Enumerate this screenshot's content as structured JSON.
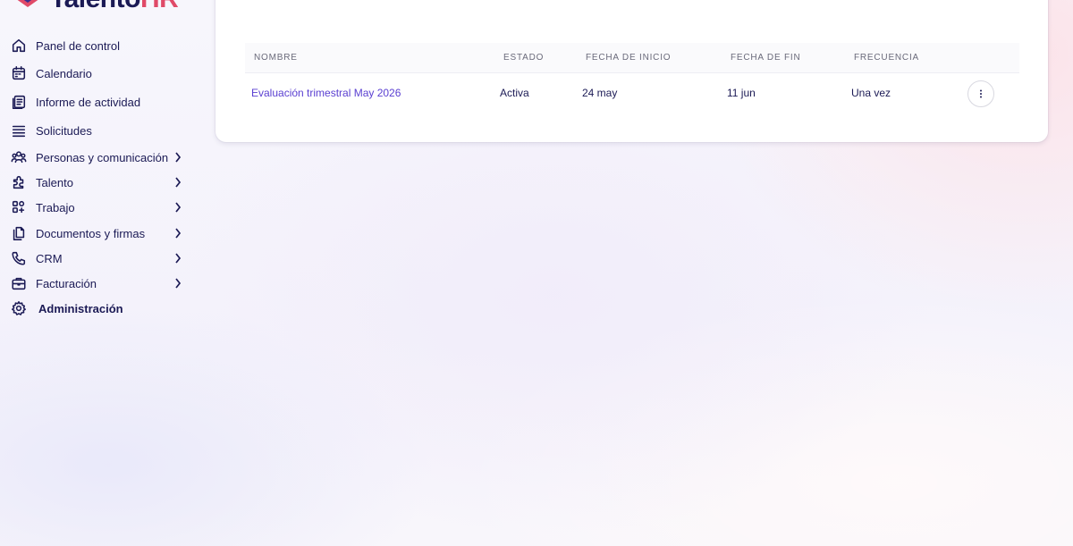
{
  "brand": {
    "name_main": "Talento",
    "name_accent": "HR",
    "colors": {
      "primary": "#1b1a55",
      "accent": "#e04a68",
      "link": "#5a3fd1"
    }
  },
  "sidebar": {
    "items": [
      {
        "label": "Panel de control",
        "icon": "home-icon",
        "has_submenu": false
      },
      {
        "label": "Calendario",
        "icon": "calendar-icon",
        "has_submenu": false
      },
      {
        "label": "Informe de actividad",
        "icon": "report-icon",
        "has_submenu": false
      },
      {
        "label": "Solicitudes",
        "icon": "list-icon",
        "has_submenu": false
      },
      {
        "label": "Personas y comunicación",
        "icon": "people-icon",
        "has_submenu": true
      },
      {
        "label": "Talento",
        "icon": "puzzle-icon",
        "has_submenu": true
      },
      {
        "label": "Trabajo",
        "icon": "grid-icon",
        "has_submenu": true
      },
      {
        "label": "Documentos y firmas",
        "icon": "documents-icon",
        "has_submenu": true
      },
      {
        "label": "CRM",
        "icon": "phone-icon",
        "has_submenu": true
      },
      {
        "label": "Facturación",
        "icon": "briefcase-icon",
        "has_submenu": true
      },
      {
        "label": "Administración",
        "icon": "gear-icon",
        "has_submenu": false
      }
    ]
  },
  "table": {
    "columns": [
      "NOMBRE",
      "ESTADO",
      "FECHA DE INICIO",
      "FECHA DE FIN",
      "FRECUENCIA"
    ],
    "rows": [
      {
        "name": "Evaluación trimestral May 2026",
        "status": "Activa",
        "start": "24 may",
        "end": "11 jun",
        "frequency": "Una vez"
      }
    ]
  }
}
